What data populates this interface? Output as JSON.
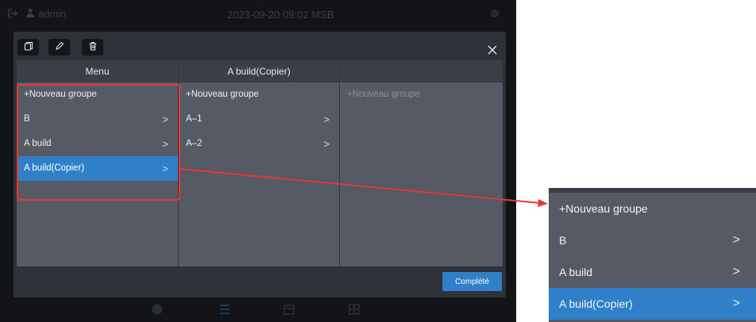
{
  "status_bar": {
    "user": "admin",
    "datetime": "2023-09-20 09:02 MSB"
  },
  "toolbar": {
    "copy_icon": "copy-icon",
    "edit_icon": "pencil-icon",
    "delete_icon": "trash-icon",
    "close_icon": "close-icon"
  },
  "columns": [
    {
      "header": "Menu",
      "rows": [
        {
          "label": "+Nouveau groupe",
          "chevron": false,
          "selected": false,
          "placeholder": false
        },
        {
          "label": "B",
          "chevron": true,
          "selected": false,
          "placeholder": false
        },
        {
          "label": "A build",
          "chevron": true,
          "selected": false,
          "placeholder": false
        },
        {
          "label": "A build(Copier)",
          "chevron": true,
          "selected": true,
          "placeholder": false
        }
      ]
    },
    {
      "header": "A build(Copier)",
      "rows": [
        {
          "label": "+Nouveau groupe",
          "chevron": false,
          "selected": false,
          "placeholder": false
        },
        {
          "label": "A–1",
          "chevron": true,
          "selected": false,
          "placeholder": false
        },
        {
          "label": "A–2",
          "chevron": true,
          "selected": false,
          "placeholder": false
        }
      ]
    },
    {
      "header": "",
      "rows": [
        {
          "label": "+Nouveau groupe",
          "chevron": false,
          "selected": false,
          "placeholder": true
        }
      ]
    }
  ],
  "complete_label": "Complété",
  "zoom_rows": [
    {
      "label": "+Nouveau groupe",
      "chevron": false,
      "selected": false
    },
    {
      "label": "B",
      "chevron": true,
      "selected": false
    },
    {
      "label": "A build",
      "chevron": true,
      "selected": false
    },
    {
      "label": "A build(Copier)",
      "chevron": true,
      "selected": true
    }
  ],
  "chevron_glyph": ">",
  "colors": {
    "accent": "#2f80c8",
    "annotation": "#e53935",
    "panel": "#555a64",
    "header": "#3a3e46"
  }
}
